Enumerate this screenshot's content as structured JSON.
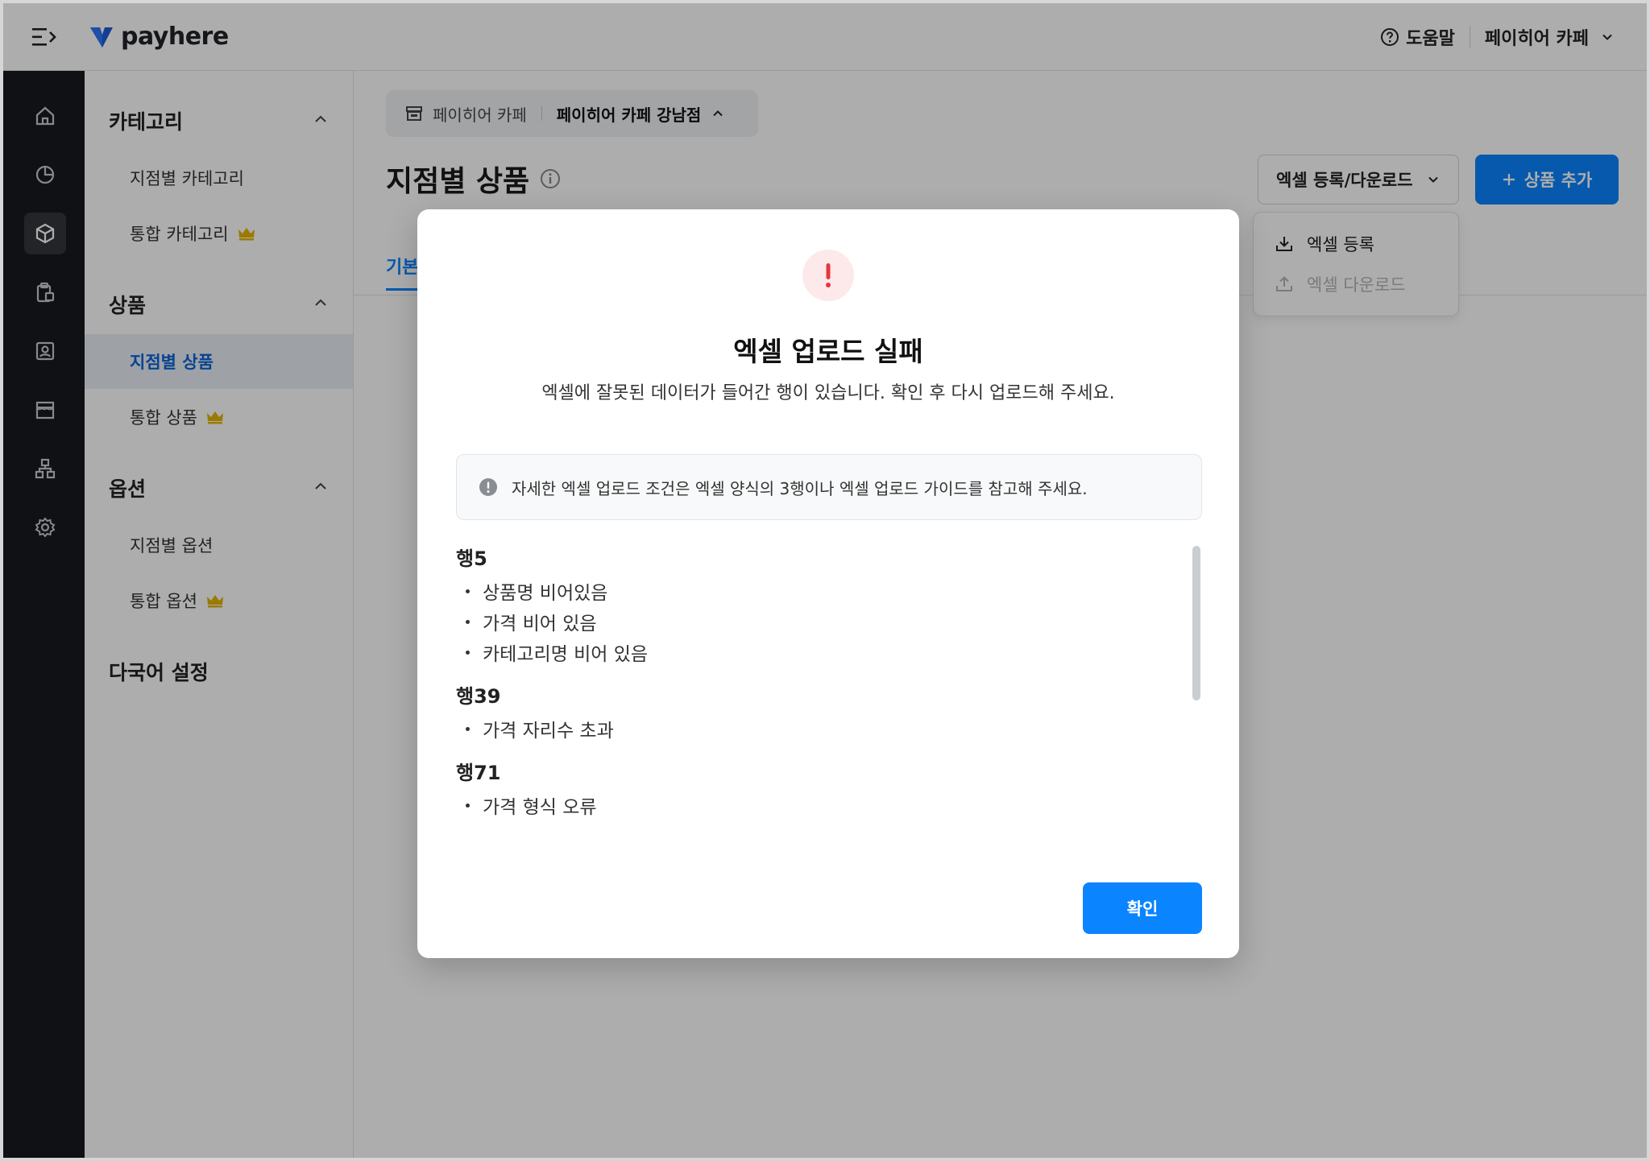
{
  "header": {
    "logo_text": "payhere",
    "help_label": "도움말",
    "store_label": "페이히어 카페"
  },
  "sidebar": {
    "sections": [
      {
        "title": "카테고리",
        "items": [
          {
            "label": "지점별 카테고리",
            "premium": false
          },
          {
            "label": "통합 카테고리",
            "premium": true
          }
        ]
      },
      {
        "title": "상품",
        "items": [
          {
            "label": "지점별 상품",
            "premium": false,
            "active": true
          },
          {
            "label": "통합 상품",
            "premium": true
          }
        ]
      },
      {
        "title": "옵션",
        "items": [
          {
            "label": "지점별 옵션",
            "premium": false
          },
          {
            "label": "통합 옵션",
            "premium": true
          }
        ]
      }
    ],
    "extra": "다국어 설정"
  },
  "main": {
    "breadcrumb": {
      "brand": "페이히어 카페",
      "store": "페이히어 카페 강남점"
    },
    "page_title": "지점별 상품",
    "excel_button": "엑셀 등록/다운로드",
    "add_button": "상품 추가",
    "tab_partial": "기본",
    "dropdown": {
      "register": "엑셀 등록",
      "download": "엑셀 다운로드"
    }
  },
  "modal": {
    "title": "엑셀 업로드 실패",
    "description": "엑셀에 잘못된 데이터가 들어간 행이 있습니다. 확인 후 다시 업로드해 주세요.",
    "notice": "자세한 엑셀 업로드 조건은 엑셀 양식의 3행이나 엑셀 업로드 가이드를 참고해 주세요.",
    "errors": [
      {
        "row": "행5",
        "items": [
          "상품명 비어있음",
          "가격 비어 있음",
          "카테고리명 비어 있음"
        ]
      },
      {
        "row": "행39",
        "items": [
          "가격 자리수 초과"
        ]
      },
      {
        "row": "행71",
        "items": [
          "가격 형식 오류"
        ]
      }
    ],
    "confirm_button": "확인"
  },
  "colors": {
    "accent": "#0a84ff",
    "rail_bg": "#191a1e",
    "premium": "#e5b400",
    "error": "#e8363f"
  }
}
